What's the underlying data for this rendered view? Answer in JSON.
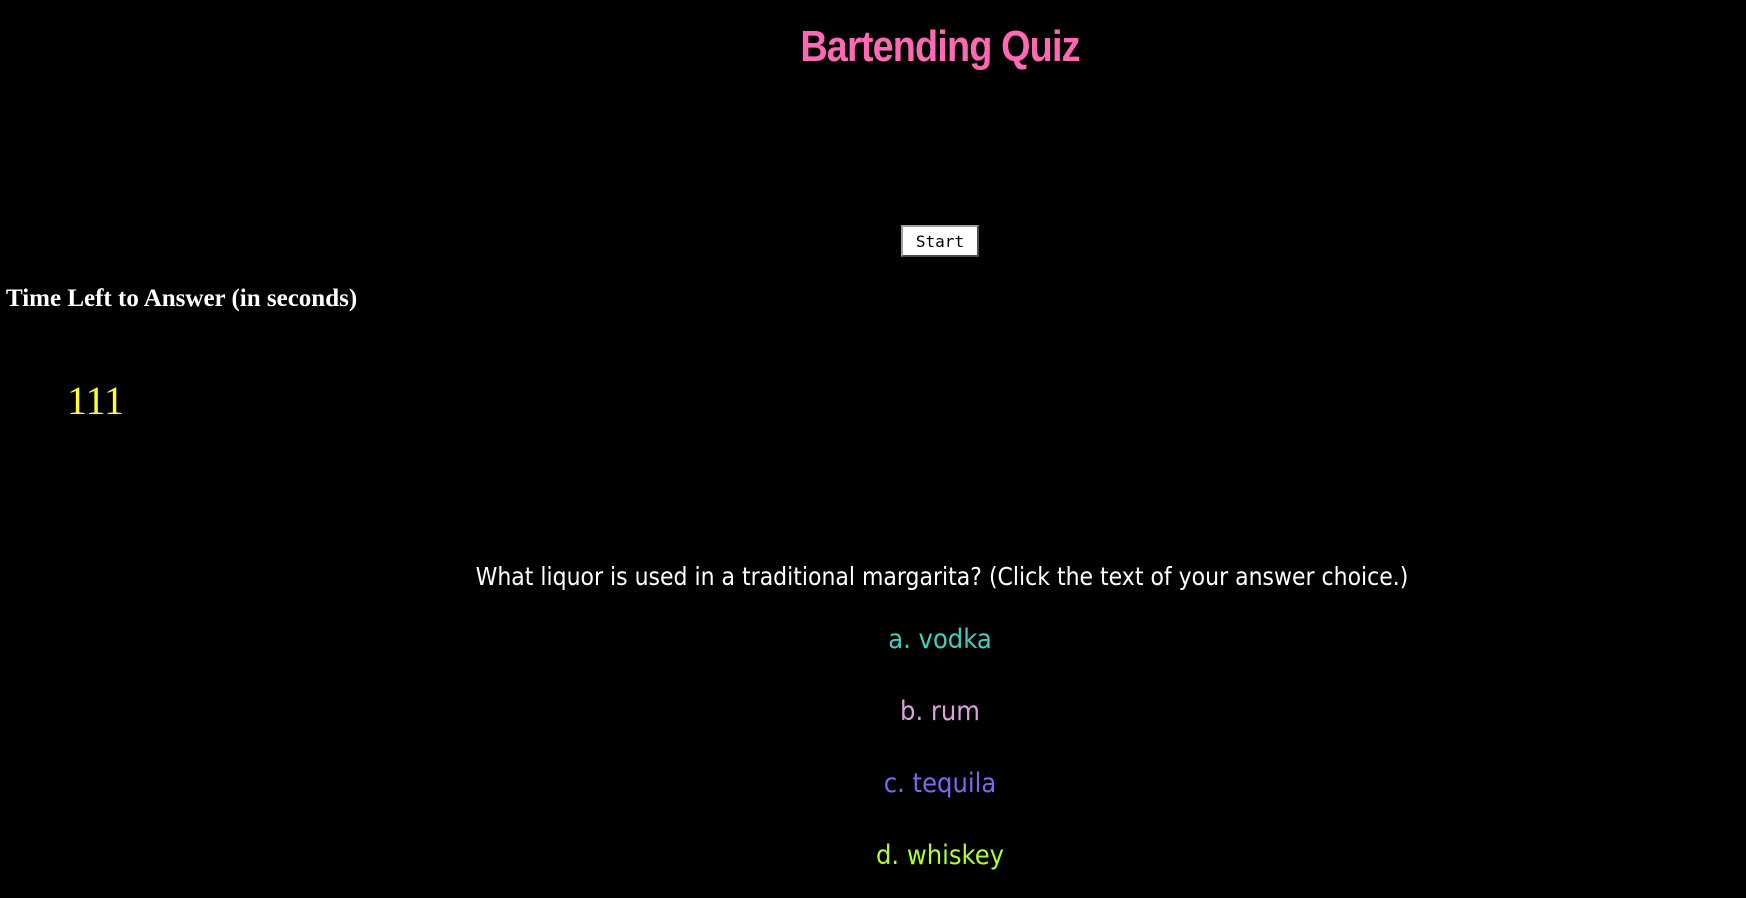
{
  "title": "Bartending Quiz",
  "start_label": "Start",
  "timer": {
    "heading": "Time Left to Answer (in seconds)",
    "value": "111"
  },
  "question": "What liquor is used in a traditional margarita? (Click the text of your answer choice.)",
  "answers": [
    {
      "label": "a. vodka",
      "color": "#40d0c0"
    },
    {
      "label": "b. rum",
      "color": "#dda0dd"
    },
    {
      "label": "c. tequila",
      "color": "#7b68ee"
    },
    {
      "label": "d. whiskey",
      "color": "#adff2f"
    }
  ],
  "colors": {
    "title": "#ff69b4",
    "timer_value": "#ffff33",
    "background": "#000000"
  }
}
